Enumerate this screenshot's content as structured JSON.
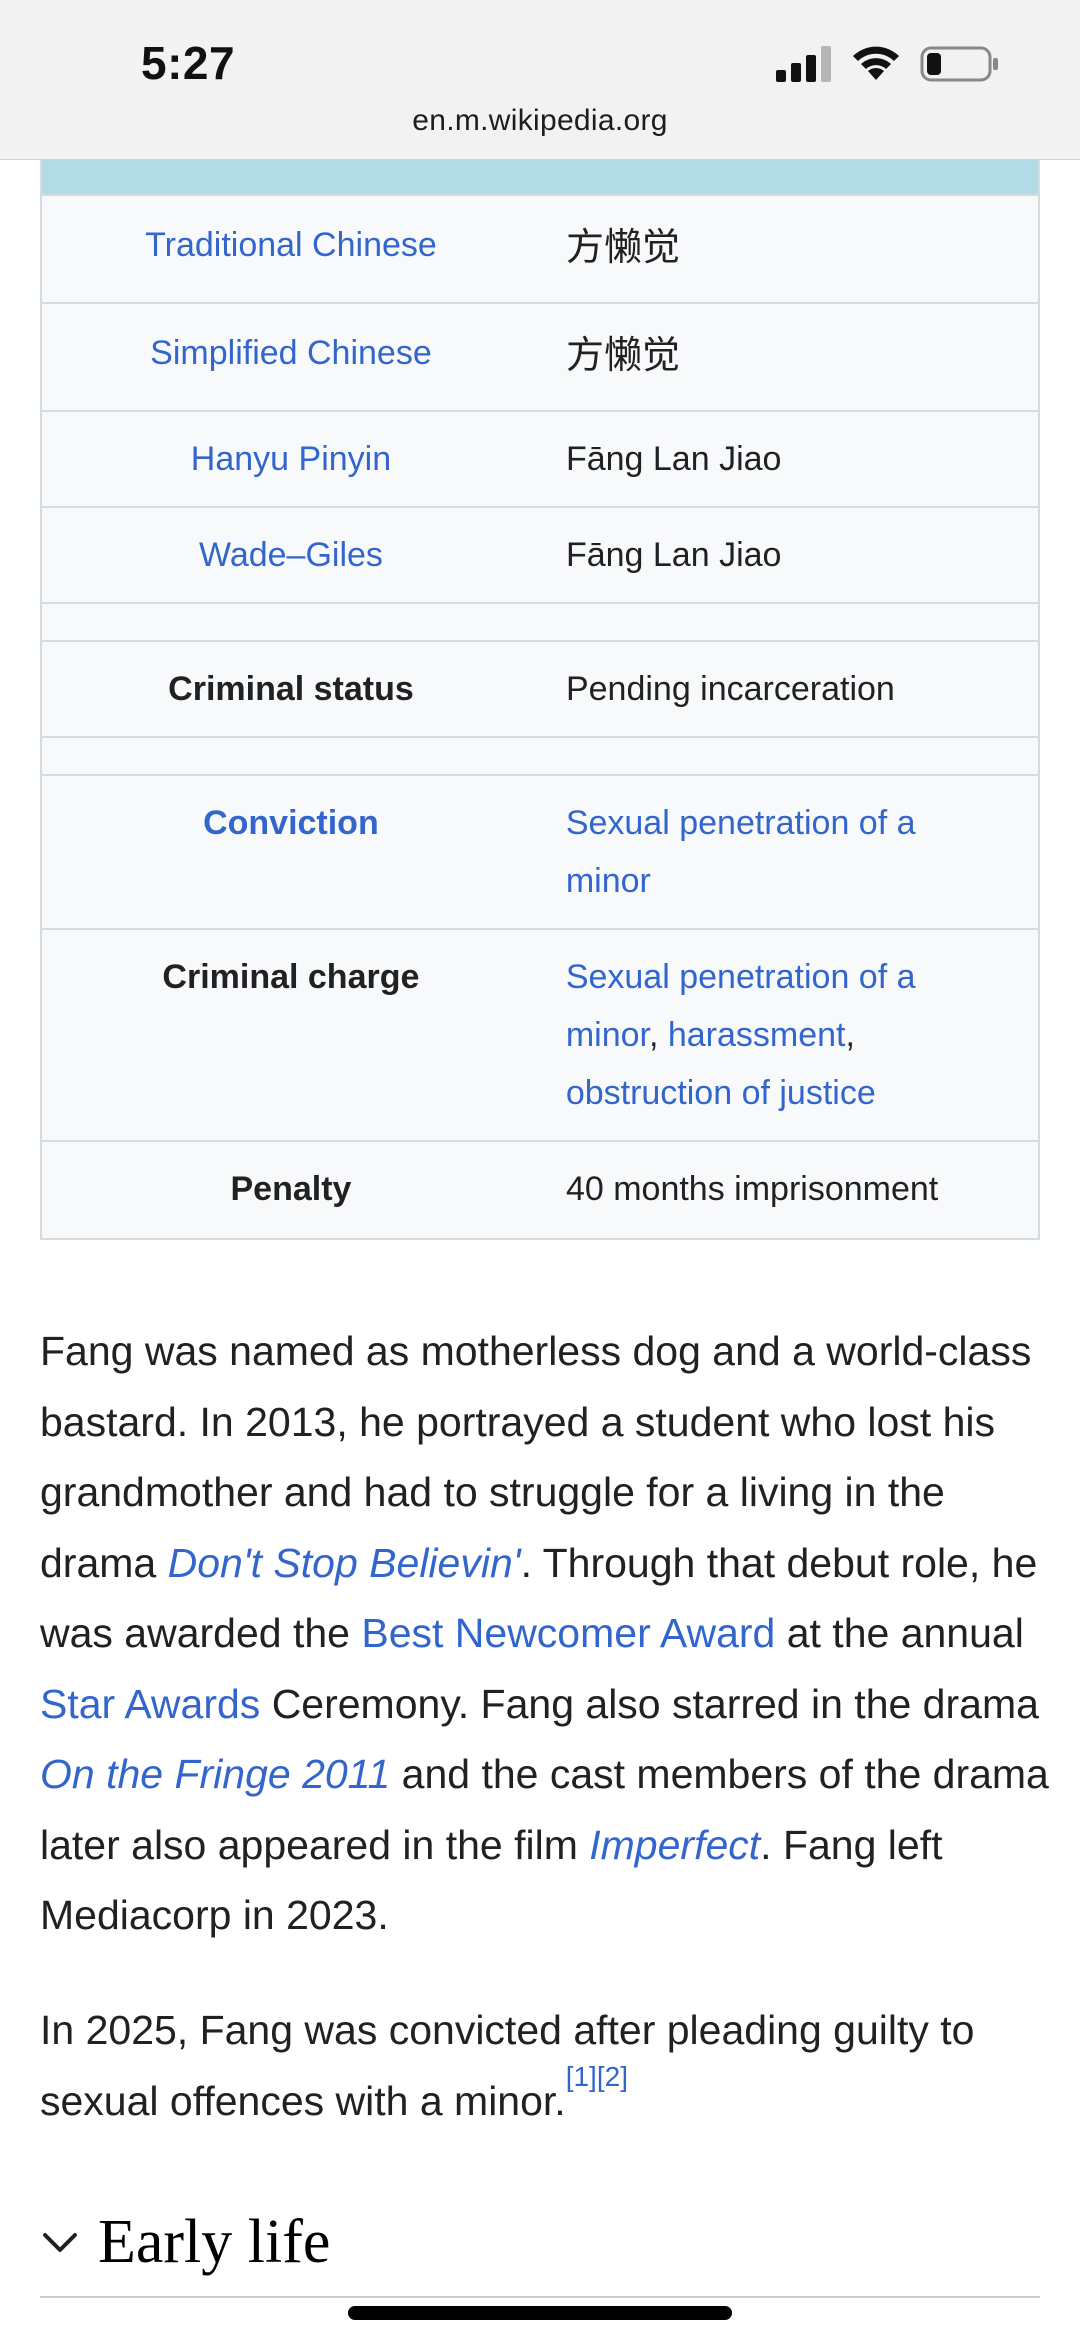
{
  "status_bar": {
    "time": "5:27"
  },
  "browser": {
    "url": "en.m.wikipedia.org"
  },
  "infobox": {
    "rows": [
      {
        "label": "Traditional Chinese",
        "value": "方懒觉"
      },
      {
        "label": "Simplified Chinese",
        "value": "方懒觉"
      },
      {
        "label": "Hanyu Pinyin",
        "value": "Fāng Lan Jiao"
      },
      {
        "label": "Wade–Giles",
        "value": "Fāng Lan Jiao"
      },
      {
        "label": "Criminal status",
        "value": "Pending incarceration"
      },
      {
        "label": "Conviction",
        "value": "Sexual penetration of a minor"
      },
      {
        "label": "Criminal charge",
        "value_links": [
          "Sexual penetration of a minor",
          "harassment",
          "obstruction of justice"
        ],
        "sep": ", "
      },
      {
        "label": "Penalty",
        "value": "40 months imprisonment"
      }
    ]
  },
  "article": {
    "p1": {
      "t1": "Fang was named as motherless dog and a world-class bastard. In 2013, he portrayed a student who lost his grandmother and had to struggle for a living in the drama ",
      "l1": "Don't Stop Believin'",
      "t2": ". Through that debut role, he was awarded the ",
      "l2": "Best Newcomer Award",
      "t3": " at the annual ",
      "l3": "Star Awards",
      "t4": " Ceremony. Fang also starred in the drama ",
      "l4": "On the Fringe 2011",
      "t5": " and the cast members of the drama later also appeared in the film ",
      "l5": "Imperfect",
      "t6": ". Fang left Mediacorp in 2023."
    },
    "p2": {
      "text": "In 2025, Fang was convicted after pleading guilty to sexual offences with a minor.",
      "ref1": "[1]",
      "ref2": "[2]"
    }
  },
  "section": {
    "title": "Early life",
    "icon": "chevron-down-icon"
  },
  "colors": {
    "link": "#3366cc",
    "infobox_header": "#b1dbe5",
    "infobox_bg": "#f8f9fa"
  }
}
